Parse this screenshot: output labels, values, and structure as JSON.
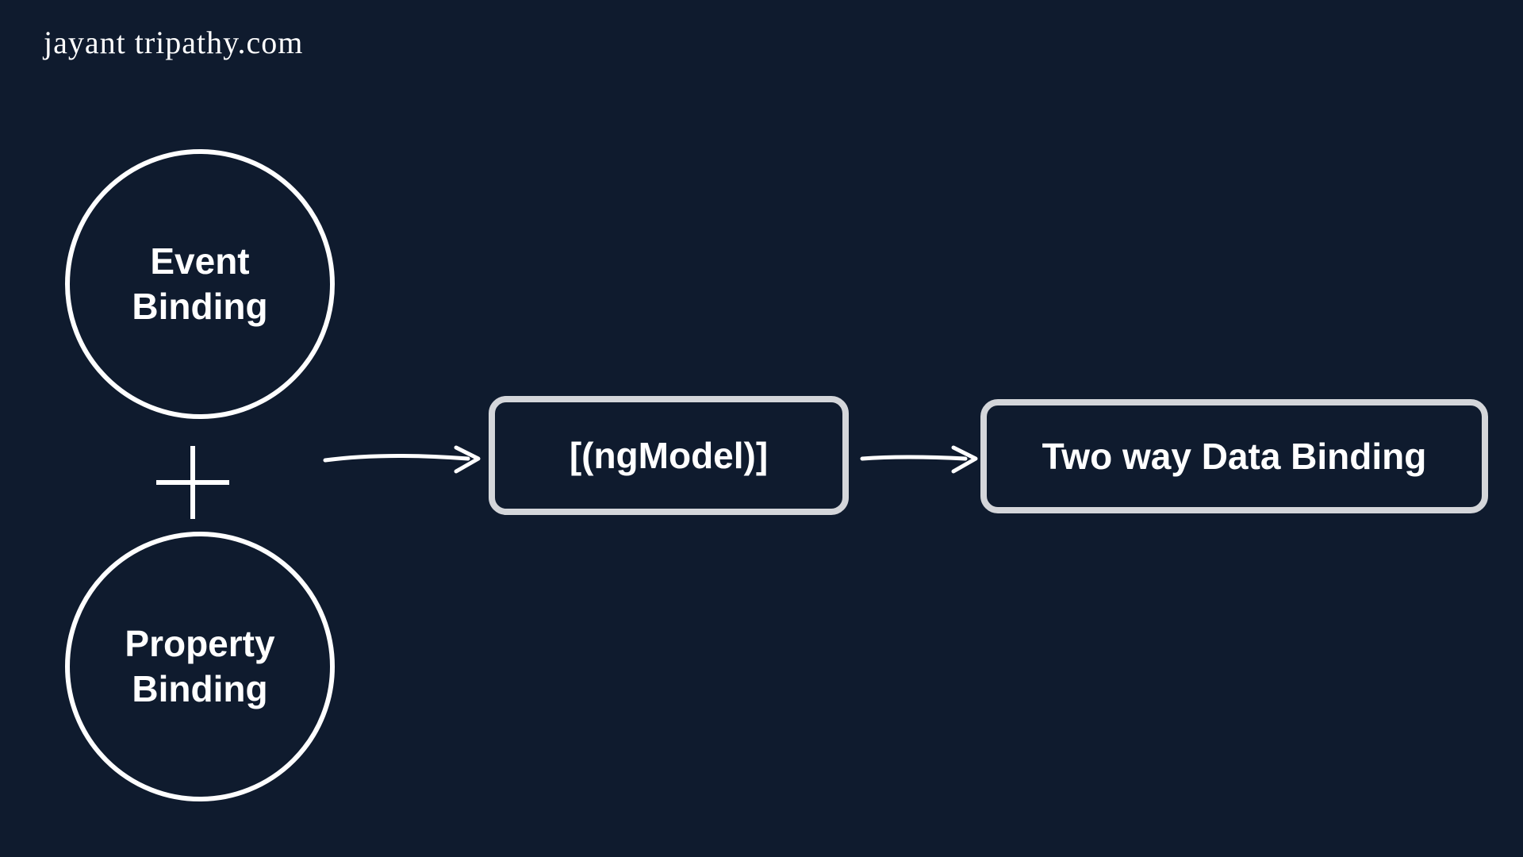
{
  "watermark": "jayant tripathy.com",
  "nodes": {
    "event_circle": {
      "line1": "Event",
      "line2": "Binding"
    },
    "property_circle": {
      "line1": "Property",
      "line2": "Binding"
    },
    "ngmodel_box": "[(ngModel)]",
    "result_box": "Two way Data Binding"
  },
  "operator": "+",
  "colors": {
    "background": "#0f1b2e",
    "stroke": "#ffffff",
    "box_border": "#d4d6da"
  }
}
